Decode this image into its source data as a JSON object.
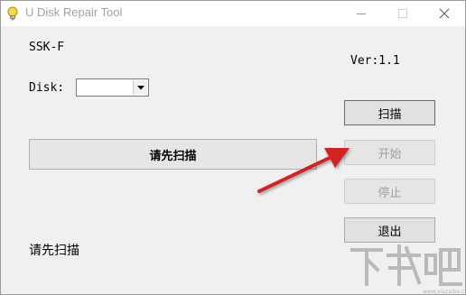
{
  "window": {
    "title": "U Disk Repair Tool"
  },
  "info": {
    "model": "SSK-F",
    "version": "Ver:1.1"
  },
  "disk": {
    "label": "Disk:",
    "selected": ""
  },
  "progress": {
    "text": "请先扫描",
    "value": 0
  },
  "buttons": {
    "scan": "扫描",
    "start": "开始",
    "stop": "停止",
    "exit": "退出"
  },
  "status": {
    "text": "请先扫描"
  },
  "watermark": {
    "text": "下载吧"
  },
  "colors": {
    "arrow": "#d32020",
    "progress_fill": "#06b025"
  }
}
